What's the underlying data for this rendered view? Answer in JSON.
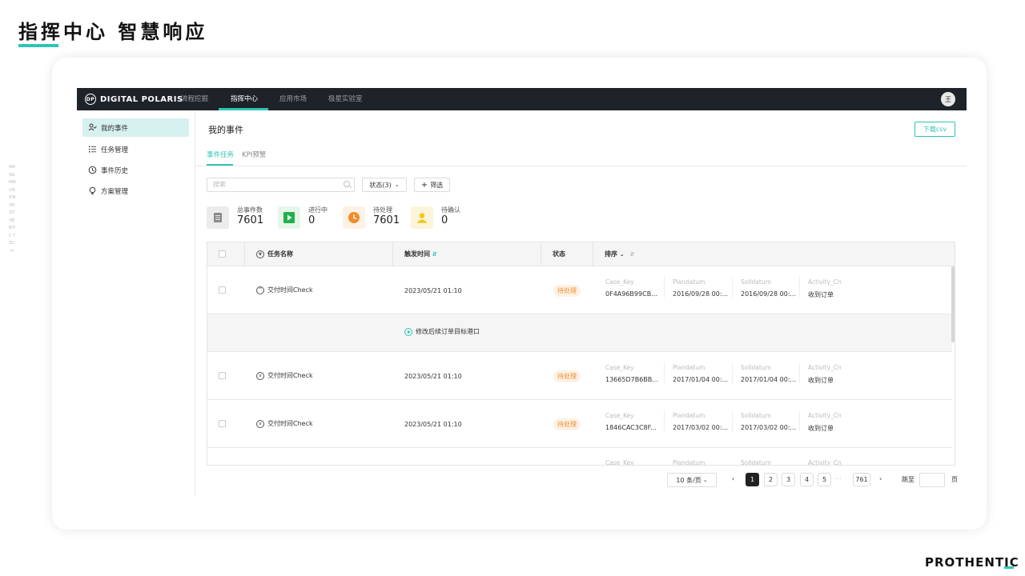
{
  "slide": {
    "title": "指挥中心 智慧响应",
    "vertical_text": "WANGYARUNXIN PROTHENTIC TECH",
    "brand": "PROTHENTIC"
  },
  "app": {
    "logo_mark": "DP",
    "logo_text": "DIGITAL POLARIS",
    "nav": [
      "流程挖掘",
      "指挥中心",
      "应用市场",
      "极星实验室"
    ],
    "active_nav": "指挥中心",
    "avatar": "王"
  },
  "sidebar": {
    "items": [
      {
        "label": "我的事件",
        "icon": "user-check-icon",
        "active": true
      },
      {
        "label": "任务管理",
        "icon": "list-icon",
        "active": false
      },
      {
        "label": "事件历史",
        "icon": "history-icon",
        "active": false
      },
      {
        "label": "方案管理",
        "icon": "lightbulb-icon",
        "active": false
      }
    ]
  },
  "main": {
    "title": "我的事件",
    "download_label": "下载csv",
    "tabs": [
      "事件任务",
      "KPI预警"
    ],
    "search_placeholder": "搜索",
    "status_filter": "状态(3)",
    "filter_label": "筛选",
    "stats": [
      {
        "label": "总事件数",
        "value": "7601",
        "icon": "document-icon",
        "color": "#e8e8e8"
      },
      {
        "label": "进行中",
        "value": "0",
        "icon": "play-icon",
        "color": "#22b04b"
      },
      {
        "label": "待处理",
        "value": "7601",
        "icon": "clock-icon",
        "color": "#f08c2b"
      },
      {
        "label": "待确认",
        "value": "0",
        "icon": "person-icon",
        "color": "#f5c518"
      }
    ]
  },
  "table": {
    "headers": {
      "task": "任务名称",
      "time": "触发时间",
      "status": "状态",
      "sort": "排序"
    },
    "detail_keys": [
      "Case_Key",
      "Plandatum",
      "Solldatum",
      "Activity_Cn"
    ],
    "rows": [
      {
        "task": "交付时间Check",
        "time": "2023/05/21 01:10",
        "status": "待处理",
        "case_key": "0F4A96B99CB...",
        "plandatum": "2016/09/28 00:...",
        "solldatum": "2016/09/28 00:...",
        "activity": "收到订单",
        "expanded": true
      },
      {
        "task": "交付时间Check",
        "time": "2023/05/21 01:10",
        "status": "待处理",
        "case_key": "13665D7B6BB...",
        "plandatum": "2017/01/04 00:...",
        "solldatum": "2017/01/04 00:...",
        "activity": "收到订单",
        "expanded": false
      },
      {
        "task": "交付时间Check",
        "time": "2023/05/21 01:10",
        "status": "待处理",
        "case_key": "1846CAC3C8F...",
        "plandatum": "2017/03/02 00:...",
        "solldatum": "2017/03/02 00:...",
        "activity": "收到订单",
        "expanded": false
      }
    ],
    "expanded_detail": "修改后续订单目标港口"
  },
  "pagination": {
    "page_size": "10 条/页",
    "pages": [
      "1",
      "2",
      "3",
      "4",
      "5"
    ],
    "current": "1",
    "ellipsis": "···",
    "last": "761",
    "jump_label": "跳至",
    "page_suffix": "页"
  }
}
